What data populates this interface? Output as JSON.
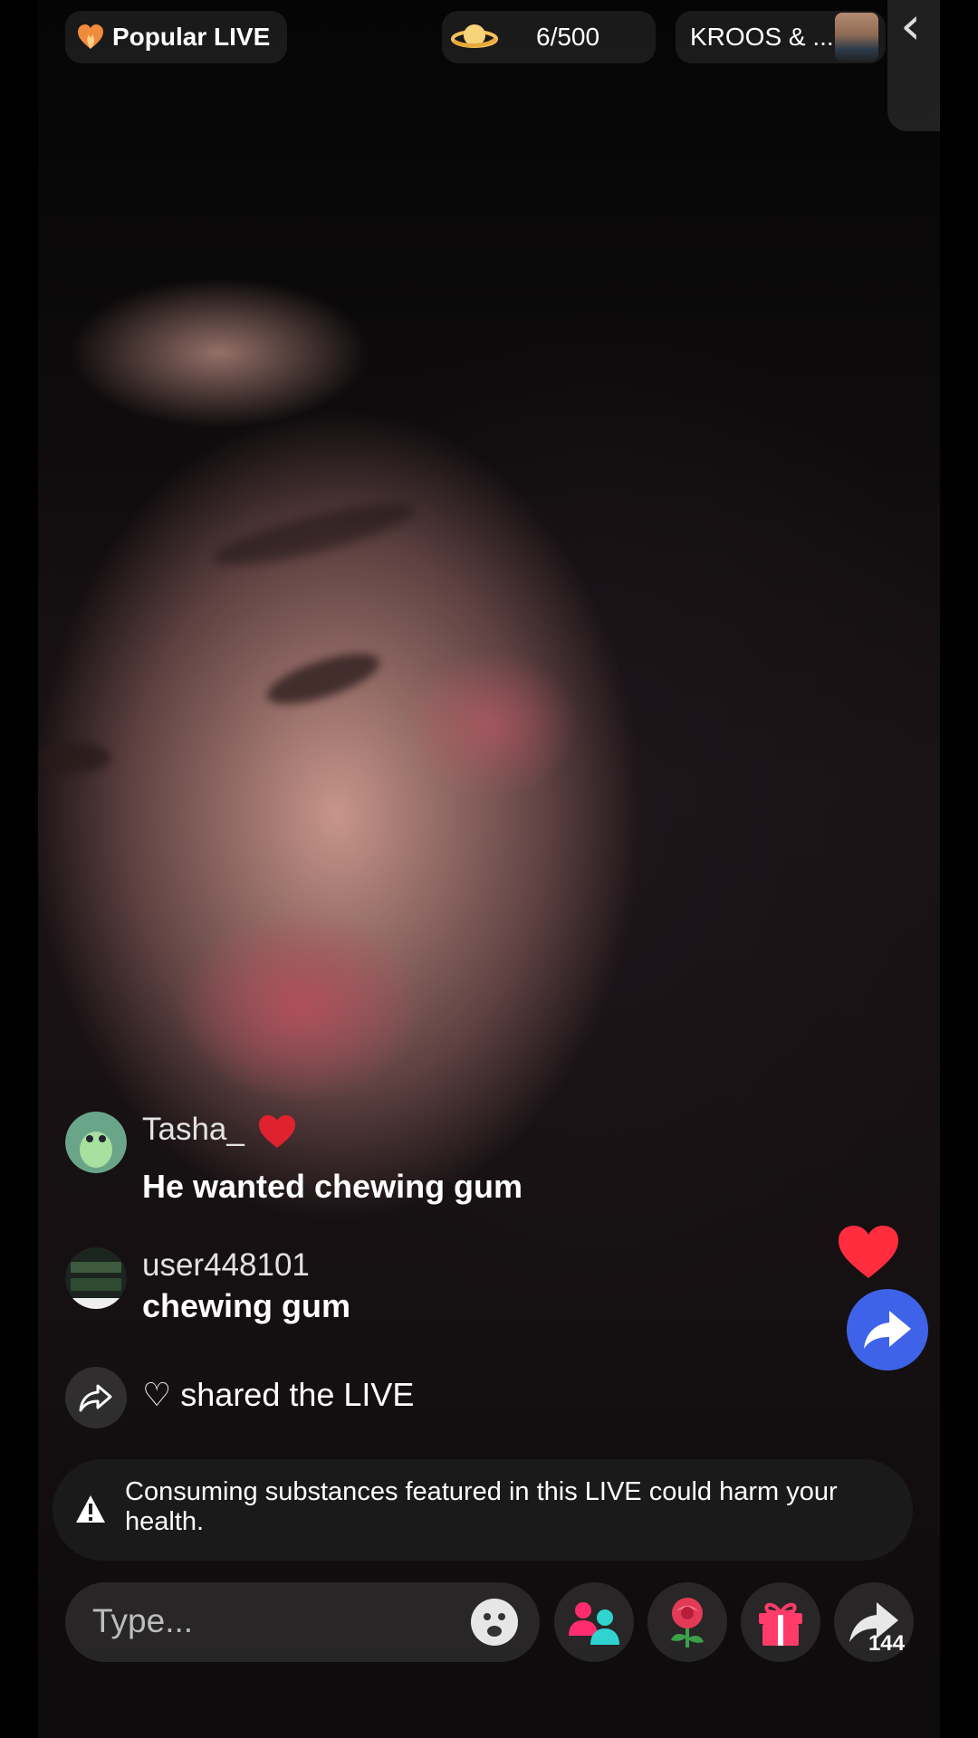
{
  "top_bar": {
    "popular_label": "Popular LIVE",
    "viewer_count": "6/500",
    "ranking_label": "KROOS & ..."
  },
  "comments": [
    {
      "username": "Tasha_",
      "message": "He wanted chewing gum"
    },
    {
      "username": "user448101",
      "message": "chewing gum"
    }
  ],
  "share_notice": "♡ shared the LIVE",
  "warning": {
    "text": "Consuming substances featured in this LIVE could harm your health."
  },
  "input": {
    "placeholder": "Type..."
  },
  "bottom_bar": {
    "share_count": "144"
  },
  "colors": {
    "heart": "#ff2d3d",
    "share_fab": "#3f63e8",
    "popular_icon": "#f08a3c",
    "gift": "#ff3b6a",
    "rose": "#e23a57"
  }
}
